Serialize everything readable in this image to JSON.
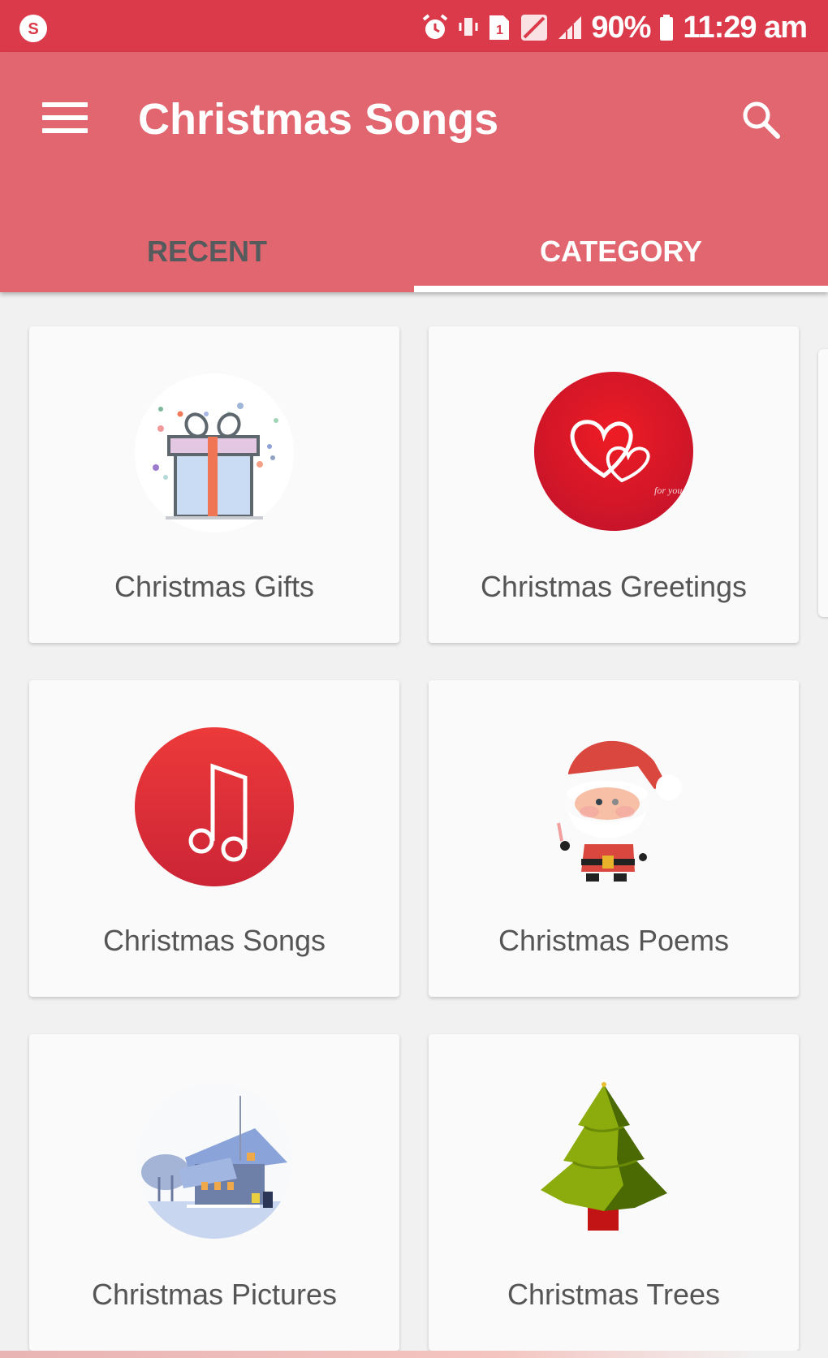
{
  "status_bar": {
    "battery_percent": "90%",
    "time": "11:29 am",
    "icons": [
      "app-notification-icon",
      "alarm-icon",
      "vibrate-icon",
      "sim-icon",
      "no-signal-icon",
      "signal-icon",
      "battery-icon"
    ]
  },
  "app_bar": {
    "title": "Christmas Songs",
    "menu_icon": "hamburger-menu-icon",
    "search_icon": "search-icon"
  },
  "tabs": [
    {
      "label": "RECENT",
      "active": false
    },
    {
      "label": "CATEGORY",
      "active": true
    }
  ],
  "categories": [
    {
      "label": "Christmas Gifts",
      "icon": "gift-icon"
    },
    {
      "label": "Christmas Greetings",
      "icon": "hearts-icon"
    },
    {
      "label": "Christmas Songs",
      "icon": "music-note-icon"
    },
    {
      "label": "Christmas Poems",
      "icon": "santa-icon"
    },
    {
      "label": "Christmas Pictures",
      "icon": "snow-house-icon"
    },
    {
      "label": "Christmas Trees",
      "icon": "tree-icon"
    }
  ],
  "colors": {
    "status_bar": "#da3a4a",
    "app_bar": "#e16670",
    "background": "#f1f1f1",
    "card": "#fafafa"
  }
}
